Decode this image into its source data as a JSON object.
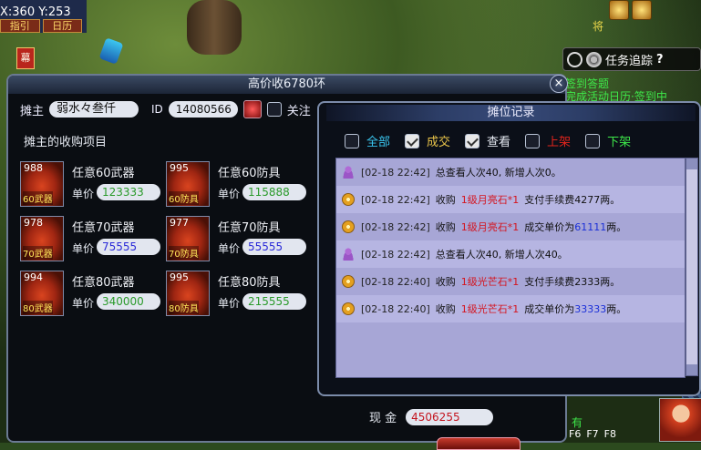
{
  "game": {
    "coords": "X:360 Y:253",
    "hint_buttons": [
      "指引",
      "日历"
    ],
    "flag_glyph": "幕",
    "char_name": "将",
    "quest_track_label": "任务追踪",
    "quest_help": "?",
    "quest_items": [
      "签到答题",
      "完成活动日历·签到中"
    ],
    "fkeys": [
      "F6",
      "F7",
      "F8"
    ],
    "bottom_hint": "有"
  },
  "window": {
    "title": "高价收6780环",
    "close": "×",
    "owner_label": "摊主",
    "owner_name": "弱水々叁仟",
    "id_label": "ID",
    "owner_id": "14080566",
    "follow_label": "关注",
    "section_title": "摊主的收购项目",
    "price_label": "单价",
    "items": [
      {
        "count": "988",
        "tag": "60武器",
        "name": "任意60武器",
        "price": "123333",
        "color": "#2a9a2a"
      },
      {
        "count": "995",
        "tag": "60防具",
        "name": "任意60防具",
        "price": "115888",
        "color": "#2a9a2a"
      },
      {
        "count": "978",
        "tag": "70武器",
        "name": "任意70武器",
        "price": "75555",
        "color": "#2a2ad8"
      },
      {
        "count": "977",
        "tag": "70防具",
        "name": "任意70防具",
        "price": "55555",
        "color": "#2a2ad8"
      },
      {
        "count": "994",
        "tag": "80武器",
        "name": "任意80武器",
        "price": "340000",
        "color": "#2a9a2a"
      },
      {
        "count": "995",
        "tag": "80防具",
        "name": "任意80防具",
        "price": "215555",
        "color": "#2a9a2a"
      }
    ],
    "cash_label": "现 金",
    "cash_value": "4506255"
  },
  "records": {
    "title": "摊位记录",
    "filters": [
      {
        "label": "全部",
        "checked": false,
        "color": "#3ac6f0"
      },
      {
        "label": "成交",
        "checked": true,
        "color": "#e9c44a"
      },
      {
        "label": "查看",
        "checked": true,
        "color": "#e6eaf2"
      },
      {
        "label": "上架",
        "checked": false,
        "color": "#e0241c"
      },
      {
        "label": "下架",
        "checked": false,
        "color": "#3ee84a"
      }
    ],
    "rows": [
      {
        "icon": "person",
        "time": "[02-18 22:42]",
        "a": "总查看人次40, 新增人次0。",
        "b": "",
        "c": "",
        "d": ""
      },
      {
        "icon": "coin",
        "time": "[02-18 22:42]",
        "a": "收购",
        "b": "1级月亮石*1",
        "c": "支付手续费4277两。",
        "d": ""
      },
      {
        "icon": "coin",
        "time": "[02-18 22:42]",
        "a": "收购",
        "b": "1级月亮石*1",
        "c": "成交单价为",
        "d": "61111",
        "e": "两。"
      },
      {
        "icon": "person",
        "time": "[02-18 22:42]",
        "a": "总查看人次40, 新增人次40。",
        "b": "",
        "c": "",
        "d": ""
      },
      {
        "icon": "coin",
        "time": "[02-18 22:40]",
        "a": "收购",
        "b": "1级光芒石*1",
        "c": "支付手续费2333两。",
        "d": ""
      },
      {
        "icon": "coin",
        "time": "[02-18 22:40]",
        "a": "收购",
        "b": "1级光芒石*1",
        "c": "成交单价为",
        "d": "33333",
        "e": "两。"
      }
    ]
  }
}
